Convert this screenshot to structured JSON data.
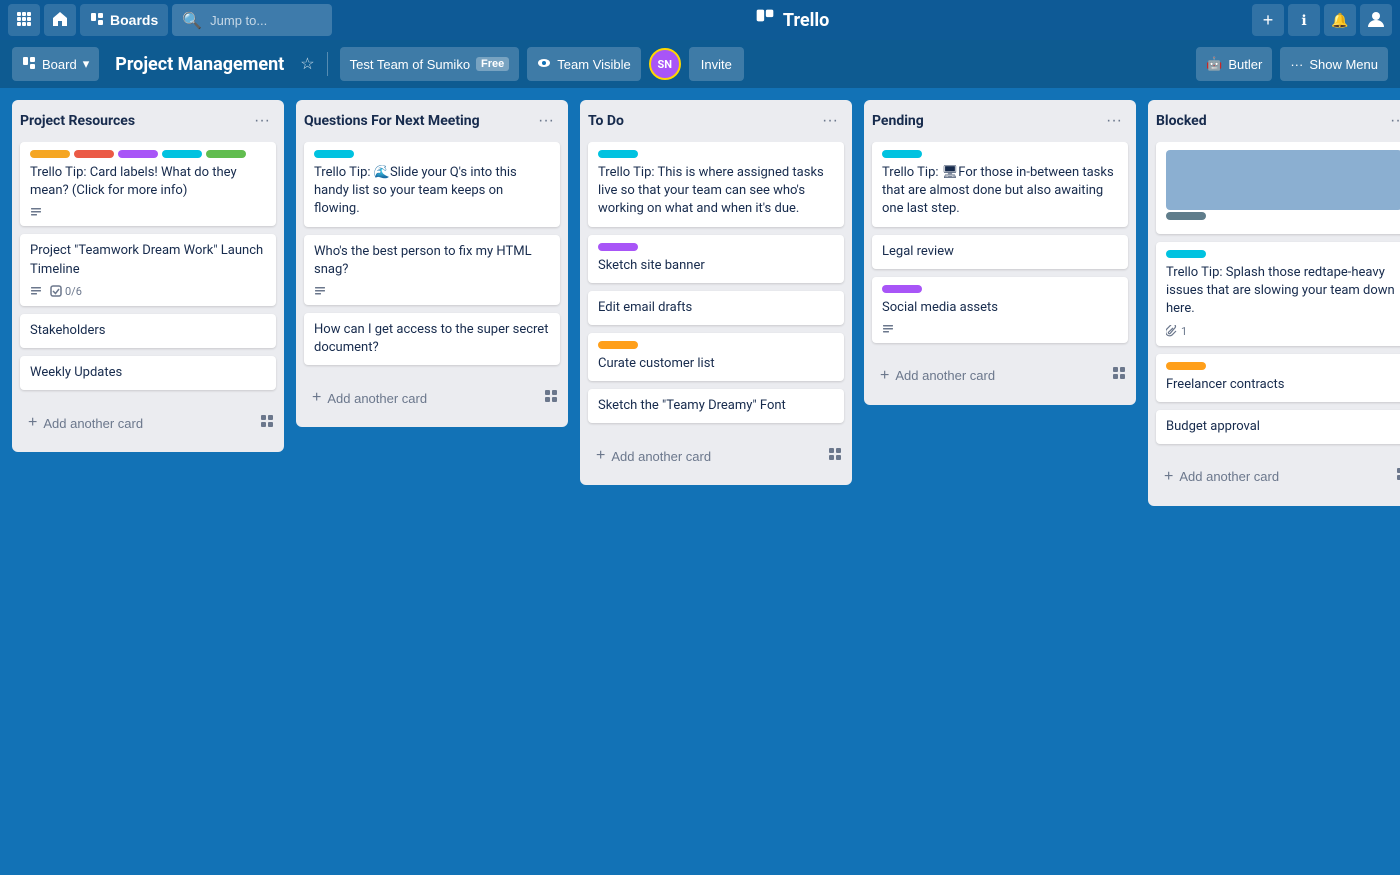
{
  "nav": {
    "apps_icon": "⊞",
    "home_icon": "⌂",
    "boards_label": "Boards",
    "search_placeholder": "Jump to...",
    "search_icon": "🔍",
    "trello_logo": "🗒",
    "trello_name": "Trello",
    "add_icon": "+",
    "info_icon": "ℹ",
    "bell_icon": "🔔",
    "user_icon": "👤"
  },
  "board_header": {
    "board_icon": "📋",
    "board_dropdown": "Board",
    "board_name": "Project Management",
    "star_icon": "☆",
    "team_name": "Test Team of Sumiko",
    "team_free": "Free",
    "team_visible_icon": "👁",
    "team_visible_label": "Team Visible",
    "avatar_initials": "SN",
    "invite_label": "Invite",
    "butler_icon": "🤖",
    "butler_label": "Butler",
    "menu_dots": "···",
    "show_menu_label": "Show Menu"
  },
  "lists": [
    {
      "id": "project-resources",
      "title": "Project Resources",
      "cards": [
        {
          "id": "pr-1",
          "labels": [
            {
              "color": "#f5a623"
            },
            {
              "color": "#eb5a46"
            },
            {
              "color": "#a855f7"
            },
            {
              "color": "#00c2e0"
            },
            {
              "color": "#61bd4f"
            }
          ],
          "text": "Trello Tip: Card labels! What do they mean? (Click for more info)",
          "footer": {
            "description": true
          }
        },
        {
          "id": "pr-2",
          "labels": [],
          "text": "Project \"Teamwork Dream Work\" Launch Timeline",
          "footer": {
            "description": true,
            "checklist": "0/6"
          }
        },
        {
          "id": "pr-3",
          "labels": [],
          "text": "Stakeholders",
          "footer": {}
        },
        {
          "id": "pr-4",
          "labels": [],
          "text": "Weekly Updates",
          "footer": {}
        }
      ],
      "add_card_label": "Add another card"
    },
    {
      "id": "questions-next-meeting",
      "title": "Questions For Next Meeting",
      "cards": [
        {
          "id": "qm-1",
          "labels": [
            {
              "color": "#00c2e0"
            }
          ],
          "text": "Trello Tip: 🌊Slide your Q's into this handy list so your team keeps on flowing.",
          "footer": {}
        },
        {
          "id": "qm-2",
          "labels": [],
          "text": "Who's the best person to fix my HTML snag?",
          "footer": {
            "description": true
          }
        },
        {
          "id": "qm-3",
          "labels": [],
          "text": "How can I get access to the super secret document?",
          "footer": {}
        }
      ],
      "add_card_label": "Add another card"
    },
    {
      "id": "to-do",
      "title": "To Do",
      "cards": [
        {
          "id": "td-1",
          "labels": [
            {
              "color": "#00c2e0"
            }
          ],
          "text": "Trello Tip: This is where assigned tasks live so that your team can see who's working on what and when it's due.",
          "footer": {}
        },
        {
          "id": "td-2",
          "labels": [
            {
              "color": "#a855f7"
            }
          ],
          "text": "Sketch site banner",
          "footer": {}
        },
        {
          "id": "td-3",
          "labels": [],
          "text": "Edit email drafts",
          "footer": {}
        },
        {
          "id": "td-4",
          "labels": [
            {
              "color": "#ff9f1a"
            }
          ],
          "text": "Curate customer list",
          "footer": {}
        },
        {
          "id": "td-5",
          "labels": [],
          "text": "Sketch the \"Teamy Dreamy\" Font",
          "footer": {}
        }
      ],
      "add_card_label": "Add another card"
    },
    {
      "id": "pending",
      "title": "Pending",
      "cards": [
        {
          "id": "pe-1",
          "labels": [
            {
              "color": "#00c2e0"
            }
          ],
          "text": "Trello Tip: 🖥For those in-between tasks that are almost done but also awaiting one last step.",
          "footer": {}
        },
        {
          "id": "pe-2",
          "labels": [],
          "text": "Legal review",
          "footer": {}
        },
        {
          "id": "pe-3",
          "labels": [
            {
              "color": "#a855f7"
            }
          ],
          "text": "Social media assets",
          "footer": {
            "description": true
          }
        }
      ],
      "add_card_label": "Add another card"
    },
    {
      "id": "blocked",
      "title": "Blocked",
      "cards": [
        {
          "id": "bl-1",
          "labels": [
            {
              "color": "#607d8b"
            }
          ],
          "text": "",
          "footer": {},
          "is_image": true
        },
        {
          "id": "bl-2",
          "labels": [
            {
              "color": "#00c2e0"
            }
          ],
          "text": "Trello Tip: Splash those redtape-heavy issues that are slowing your team down here.",
          "footer": {
            "attachment": "1"
          }
        },
        {
          "id": "bl-3",
          "labels": [
            {
              "color": "#ff9f1a"
            }
          ],
          "text": "Freelancer contracts",
          "footer": {}
        },
        {
          "id": "bl-4",
          "labels": [],
          "text": "Budget approval",
          "footer": {}
        }
      ],
      "add_card_label": "Add another card"
    }
  ]
}
